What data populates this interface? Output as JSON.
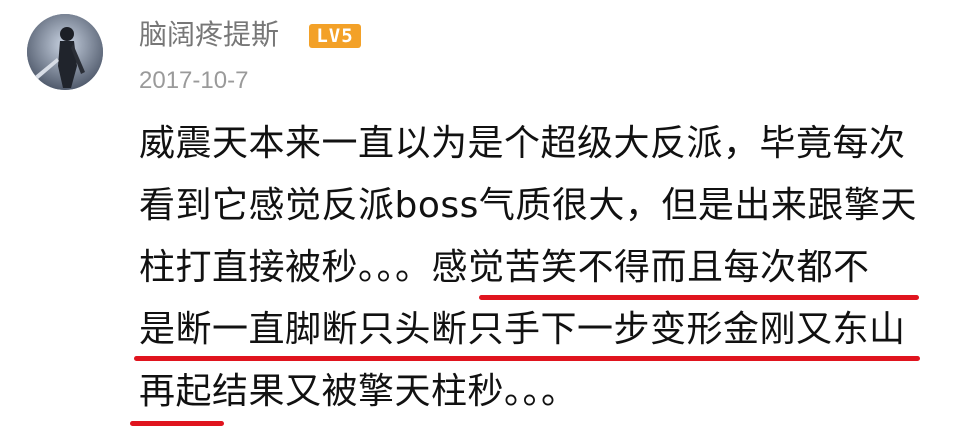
{
  "comment": {
    "username": "脑阔疼提斯",
    "level_badge": "LV5",
    "date": "2017-10-7",
    "lines": [
      "威震天本来一直以为是个超级大反派，毕竟每次",
      "看到它感觉反派boss气质很大，但是出来跟擎天",
      "柱打直接被秒。。。感觉苦笑不得而且每次都不",
      "是断一直脚断只头断只手下一步变形金刚又东山",
      "再起结果又被擎天柱秒。。。"
    ]
  },
  "colors": {
    "underline": "#e0141e",
    "badge": "#f3a128",
    "username": "#777777",
    "date": "#9a9a9a",
    "text": "#111111"
  }
}
